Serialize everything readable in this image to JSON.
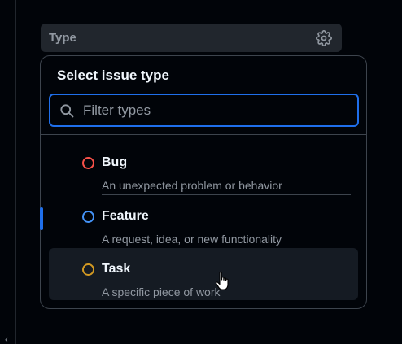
{
  "colors": {
    "background": "#010409",
    "surface": "#21262d",
    "active_row": "#151b23",
    "border": "#3d444d",
    "accent_blue": "#1f6feb",
    "text_primary": "#f0f6fc",
    "text_muted": "#9198a1",
    "type_bug": "#f85149",
    "type_feature": "#4493f8",
    "type_task": "#d29922"
  },
  "sidebar_section": {
    "label": "Type",
    "settings_icon": "gear-icon"
  },
  "popover": {
    "title": "Select issue type",
    "filter": {
      "placeholder": "Filter types",
      "value": "",
      "icon": "search-icon"
    },
    "options": [
      {
        "name": "Bug",
        "description": "An unexpected problem or behavior",
        "color": "#f85149",
        "active": false
      },
      {
        "name": "Feature",
        "description": "A request, idea, or new functionality",
        "color": "#4493f8",
        "active": false
      },
      {
        "name": "Task",
        "description": "A specific piece of work",
        "color": "#d29922",
        "active": true
      }
    ]
  },
  "cursor": {
    "icon": "hand-pointer-icon"
  }
}
